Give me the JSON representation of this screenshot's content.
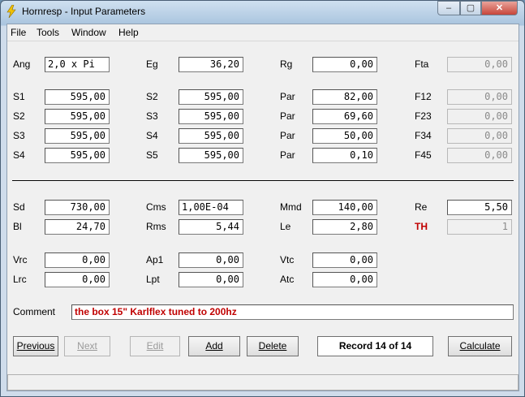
{
  "window": {
    "title": "Hornresp - Input Parameters",
    "min_icon": "minimize-icon",
    "max_icon": "maximize-icon",
    "close_icon": "close-icon",
    "close_glyph": "✕",
    "min_glyph": "–",
    "max_glyph": "▢"
  },
  "menu": [
    "File",
    "Tools",
    "Window",
    "Help"
  ],
  "rows": {
    "ang": {
      "label": "Ang",
      "value": "2,0 x Pi"
    },
    "eg": {
      "label": "Eg",
      "value": "36,20"
    },
    "rg": {
      "label": "Rg",
      "value": "0,00"
    },
    "fta": {
      "label": "Fta",
      "value": "0,00"
    },
    "s1": {
      "label": "S1",
      "value": "595,00"
    },
    "s2a": {
      "label": "S2",
      "value": "595,00"
    },
    "s3a": {
      "label": "S3",
      "value": "595,00"
    },
    "s4a": {
      "label": "S4",
      "value": "595,00"
    },
    "s2b": {
      "label": "S2",
      "value": "595,00"
    },
    "s3b": {
      "label": "S3",
      "value": "595,00"
    },
    "s4b": {
      "label": "S4",
      "value": "595,00"
    },
    "s5": {
      "label": "S5",
      "value": "595,00"
    },
    "par1": {
      "label": "Par",
      "value": "82,00"
    },
    "par2": {
      "label": "Par",
      "value": "69,60"
    },
    "par3": {
      "label": "Par",
      "value": "50,00"
    },
    "par4": {
      "label": "Par",
      "value": "0,10"
    },
    "f12": {
      "label": "F12",
      "value": "0,00"
    },
    "f23": {
      "label": "F23",
      "value": "0,00"
    },
    "f34": {
      "label": "F34",
      "value": "0,00"
    },
    "f45": {
      "label": "F45",
      "value": "0,00"
    },
    "sd": {
      "label": "Sd",
      "value": "730,00"
    },
    "bl": {
      "label": "Bl",
      "value": "24,70"
    },
    "cms": {
      "label": "Cms",
      "value": "1,00E-04"
    },
    "rms": {
      "label": "Rms",
      "value": "5,44"
    },
    "mmd": {
      "label": "Mmd",
      "value": "140,00"
    },
    "le": {
      "label": "Le",
      "value": "2,80"
    },
    "re": {
      "label": "Re",
      "value": "5,50"
    },
    "th": {
      "label": "TH",
      "value": "1"
    },
    "vrc": {
      "label": "Vrc",
      "value": "0,00"
    },
    "lrc": {
      "label": "Lrc",
      "value": "0,00"
    },
    "ap1": {
      "label": "Ap1",
      "value": "0,00"
    },
    "lpt": {
      "label": "Lpt",
      "value": "0,00"
    },
    "vtc": {
      "label": "Vtc",
      "value": "0,00"
    },
    "atc": {
      "label": "Atc",
      "value": "0,00"
    }
  },
  "comment": {
    "label": "Comment",
    "value": "the box 15\" Karlflex tuned to 200hz"
  },
  "buttons": {
    "previous": "Previous",
    "next": "Next",
    "edit": "Edit",
    "add": "Add",
    "delete": "Delete",
    "calculate": "Calculate"
  },
  "record": "Record 14 of 14",
  "colors": {
    "accent_text": "#c00000"
  }
}
